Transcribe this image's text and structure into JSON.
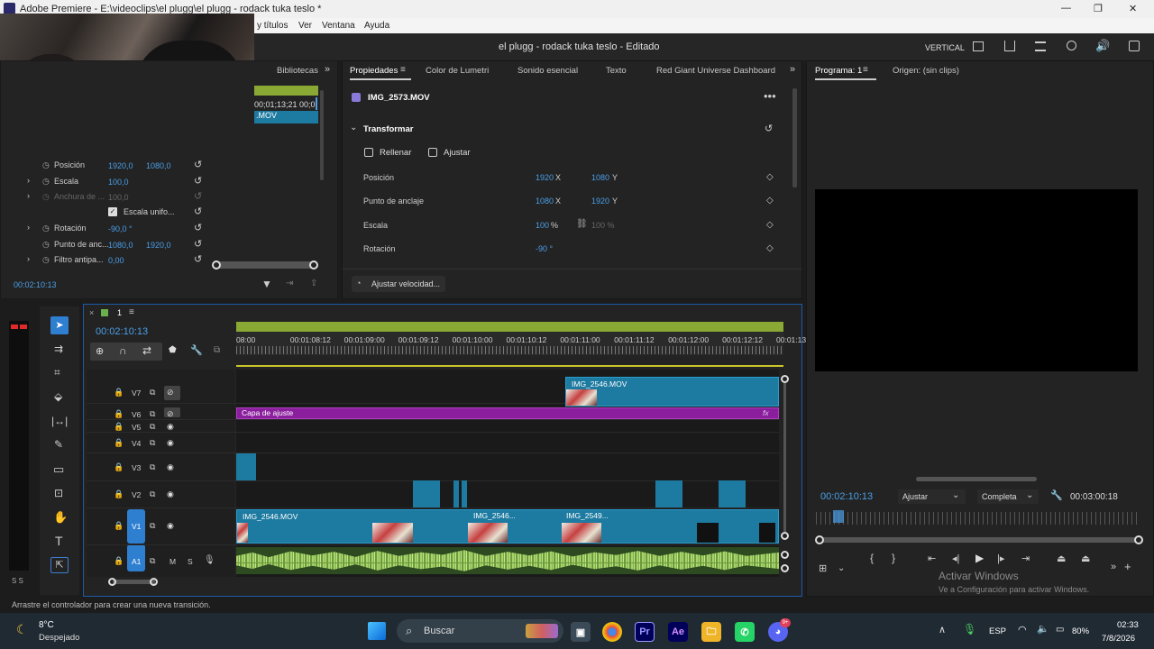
{
  "window": {
    "title": "Adobe Premiere - E:\\videoclips\\el plugg\\el plugg - rodack tuka teslo *",
    "minimize": "—",
    "maximize": "❐",
    "close": "✕"
  },
  "menu": {
    "items": [
      "y títulos",
      "Ver",
      "Ventana",
      "Ayuda"
    ]
  },
  "appbar": {
    "project_title": "el plugg - rodack tuka teslo - Editado",
    "aspect": "VERTICAL"
  },
  "left_panel": {
    "tab_bibliotecas": "Bibliotecas",
    "mini_timecodes": "00;01;13;21    00;0",
    "mini_clip": ".MOV",
    "props": [
      {
        "label": "Posición",
        "v1": "1920,0",
        "v2": "1080,0",
        "expand": false
      },
      {
        "label": "Escala",
        "v1": "100,0",
        "v2": "",
        "expand": true
      },
      {
        "label": "Anchura de ...",
        "v1": "100,0",
        "v2": "",
        "expand": true,
        "disabled": true
      },
      {
        "label": "Escala unifo...",
        "v1": "",
        "v2": "",
        "checkbox": true
      },
      {
        "label": "Rotación",
        "v1": "-90,0 °",
        "v2": "",
        "expand": true
      },
      {
        "label": "Punto de anc...",
        "v1": "1080,0",
        "v2": "1920,0",
        "expand": false
      },
      {
        "label": "Filtro antipa...",
        "v1": "0,00",
        "v2": "",
        "expand": true
      }
    ],
    "timecode": "00:02:10:13"
  },
  "props_panel": {
    "tabs": [
      "Propiedades",
      "Color de Lumetri",
      "Sonido esencial",
      "Texto",
      "Red Giant Universe Dashboard"
    ],
    "clip_name": "IMG_2573.MOV",
    "section": "Transformar",
    "fill_label": "Rellenar",
    "fit_label": "Ajustar",
    "rows": [
      {
        "label": "Posición",
        "v1": "1920",
        "u1": "X",
        "v2": "1080",
        "u2": "Y"
      },
      {
        "label": "Punto de anclaje",
        "v1": "1080",
        "u1": "X",
        "v2": "1920",
        "u2": "Y"
      },
      {
        "label": "Escala",
        "v1": "100",
        "u1": "%",
        "v2": "100 %",
        "u2": ""
      },
      {
        "label": "Rotación",
        "v1": "-90 °",
        "u1": "",
        "v2": "",
        "u2": ""
      }
    ],
    "speed_button": "Ajustar velocidad..."
  },
  "program_panel": {
    "tab_program": "Programa: 1",
    "tab_source": "Origen: (sin clips)",
    "timecode": "00:02:10:13",
    "fit": "Ajustar",
    "quality": "Completa",
    "duration": "00:03:00:18"
  },
  "timeline": {
    "sequence": "1",
    "timecode": "00:02:10:13",
    "ruler": [
      "08:00",
      "00:01:08:12",
      "00:01:09:00",
      "00:01:09:12",
      "00:01:10:00",
      "00:01:10:12",
      "00:01:11:00",
      "00:01:11:12",
      "00:01:12:00",
      "00:01:12:12",
      "00:01:13"
    ],
    "tracks": [
      "V7",
      "V6",
      "V5",
      "V4",
      "V3",
      "V2",
      "V1",
      "A1"
    ],
    "clips": {
      "v7_clip": "IMG_2546.MOV",
      "v6_clip": "Capa de ajuste",
      "v1_a": "IMG_2546.MOV",
      "v1_b": "IMG_2546...",
      "v1_c": "IMG_2549..."
    },
    "audio_flags": [
      "M",
      "S"
    ]
  },
  "status": {
    "hint": "Arrastre el controlador para crear una nueva transición."
  },
  "watermark": {
    "line1": "Activar Windows",
    "line2": "Ve a Configuración para activar Windows."
  },
  "taskbar": {
    "weather_temp": "8°C",
    "weather_desc": "Despejado",
    "search": "Buscar",
    "lang": "ESP",
    "battery": "80%",
    "time": "02:33",
    "date": "7/8/2026",
    "badge": "9+"
  },
  "colors": {
    "accent_blue": "#4a9fe8",
    "clip_blue": "#1d7aa0",
    "adjust_purple": "#8a1e9c",
    "audio_green": "#a8d36a",
    "work_area": "#8aa834"
  }
}
